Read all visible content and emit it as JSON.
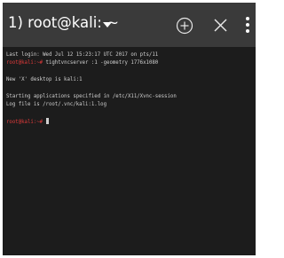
{
  "tab": {
    "title": "1) root@kali: ~",
    "dropdown_icon": "triangle-down-icon",
    "add_icon": "circle-plus-icon",
    "close_icon": "close-x-icon",
    "menu_icon": "vertical-dots-icon"
  },
  "terminal": {
    "lines": [
      "Last login: Wed Jul 12 15:23:17 UTC 2017 on pts/11",
      "tightvncserver :1 -geometry 1776x1080",
      "New 'X' desktop is kali:1",
      "Starting applications specified in /etc/X11/Xvnc-session",
      "Log file is /root/.vnc/kali:1.log"
    ],
    "prompt": "root@kali:~#",
    "prompt_color": "#e03a3a",
    "text_color": "#cfcfcf",
    "background": "#1c1c1c"
  },
  "colors": {
    "tabbar": "#3a3a3a"
  }
}
